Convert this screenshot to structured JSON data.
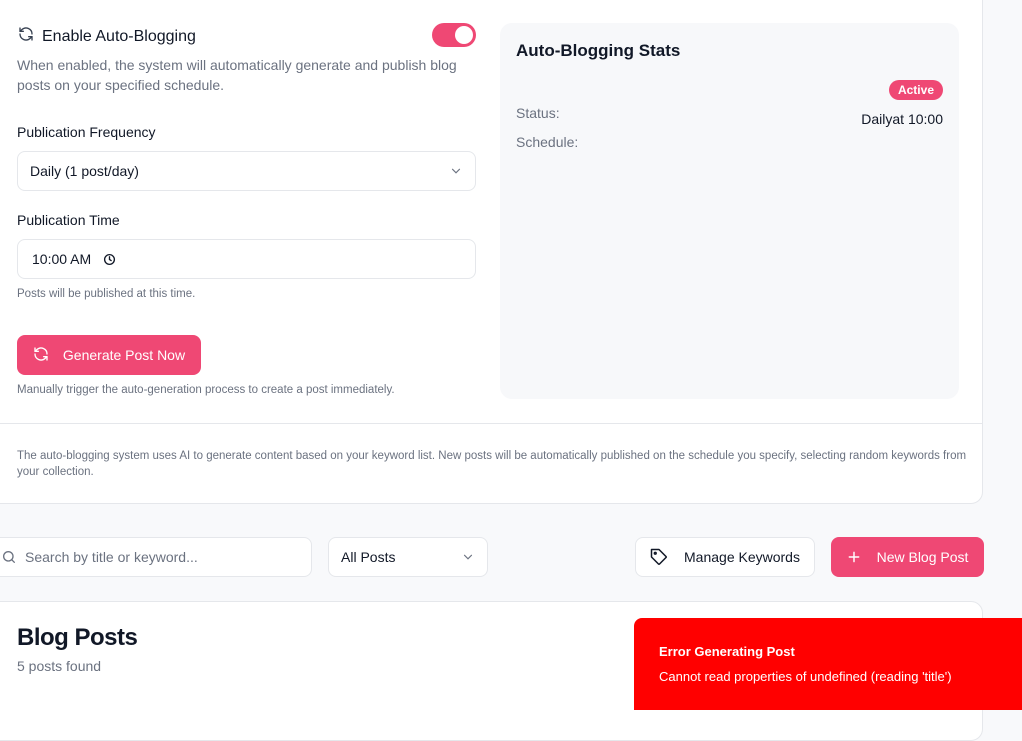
{
  "settings": {
    "toggle_label": "Enable Auto-Blogging",
    "toggle_description": "When enabled, the system will automatically generate and publish blog posts on your specified schedule.",
    "toggle_on": true,
    "frequency_label": "Publication Frequency",
    "frequency_value": "Daily (1 post/day)",
    "time_label": "Publication Time",
    "time_value": "10:00 AM",
    "time_hint": "Posts will be published at this time.",
    "generate_button": "Generate Post Now",
    "generate_hint": "Manually trigger the auto-generation process to create a post immediately.",
    "footer_note": "The auto-blogging system uses AI to generate content based on your keyword list. New posts will be automatically published on the schedule you specify, selecting random keywords from your collection."
  },
  "stats": {
    "title": "Auto-Blogging Stats",
    "status_label": "Status:",
    "status_value": "Active",
    "schedule_label": "Schedule:",
    "schedule_value": "Dailyat 10:00"
  },
  "toolbar": {
    "search_placeholder": "Search by title or keyword...",
    "filter_value": "All Posts",
    "manage_keywords": "Manage Keywords",
    "new_post": "New Blog Post"
  },
  "posts": {
    "title": "Blog Posts",
    "count_text": "5 posts found"
  },
  "toast": {
    "title": "Error Generating Post",
    "message": "Cannot read properties of undefined (reading 'title')"
  },
  "colors": {
    "accent": "#ef4874",
    "error": "#ff0000"
  }
}
